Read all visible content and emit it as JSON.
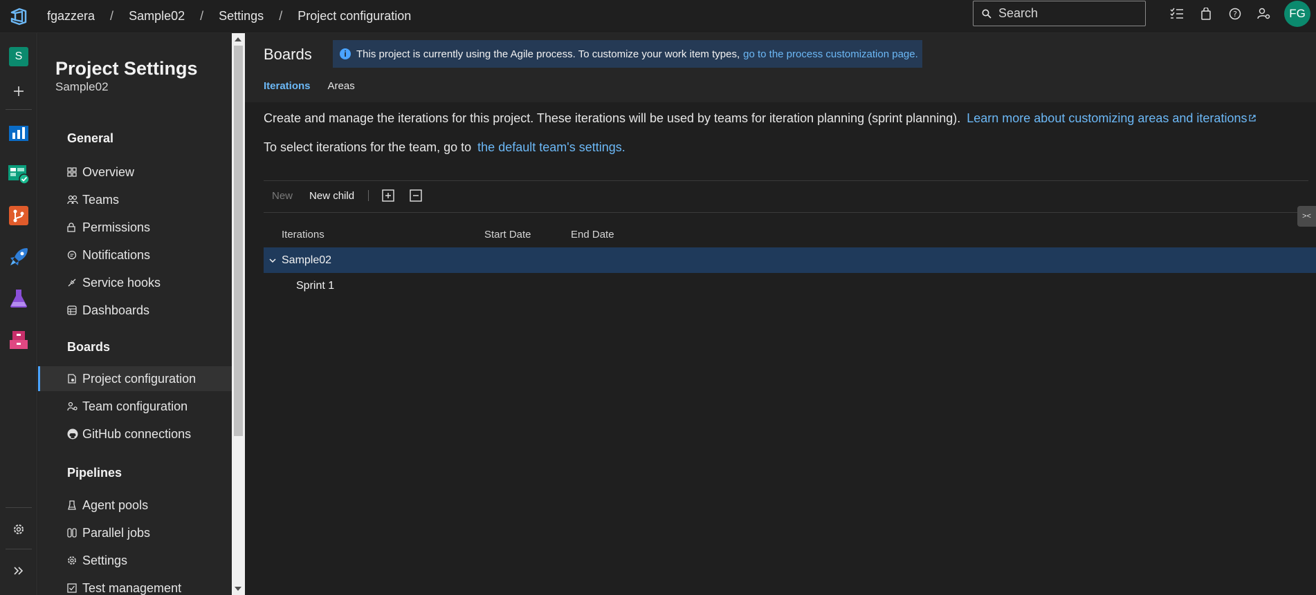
{
  "breadcrumb": {
    "org": "fgazzera",
    "project": "Sample02",
    "settings": "Settings",
    "page": "Project configuration",
    "separator": "/"
  },
  "search": {
    "placeholder": "Search"
  },
  "user": {
    "initials": "FG"
  },
  "rail": {
    "project_initial": "S"
  },
  "sidebar": {
    "title": "Project Settings",
    "subtitle": "Sample02",
    "sections": {
      "general": "General",
      "boards": "Boards",
      "pipelines": "Pipelines"
    },
    "general_items": [
      "Overview",
      "Teams",
      "Permissions",
      "Notifications",
      "Service hooks",
      "Dashboards"
    ],
    "boards_items": [
      "Project configuration",
      "Team configuration",
      "GitHub connections"
    ],
    "pipelines_items": [
      "Agent pools",
      "Parallel jobs",
      "Settings",
      "Test management"
    ]
  },
  "main": {
    "hub_title": "Boards",
    "banner": {
      "text": "This project is currently using the Agile process. To customize your work item types,",
      "link": "go to the process customization page."
    },
    "tabs": [
      "Iterations",
      "Areas"
    ],
    "description": {
      "text": "Create and manage the iterations for this project. These iterations will be used by teams for iteration planning (sprint planning).",
      "link": "Learn more about customizing areas and iterations"
    },
    "team_line": {
      "text": "To select iterations for the team, go to",
      "link": "the default team's settings."
    },
    "toolbar": {
      "new": "New",
      "new_child": "New child"
    },
    "columns": [
      "Iterations",
      "Start Date",
      "End Date"
    ],
    "rows": [
      {
        "name": "Sample02",
        "start": "",
        "end": "",
        "expanded": true,
        "selected": true
      },
      {
        "name": "Sprint 1",
        "start": "",
        "end": ""
      }
    ]
  },
  "side_tab": "><",
  "colors": {
    "accent": "#4aa3ff",
    "link": "#6cb8f6",
    "selected_row": "#1f3a5b",
    "avatar": "#0b8a6e"
  }
}
